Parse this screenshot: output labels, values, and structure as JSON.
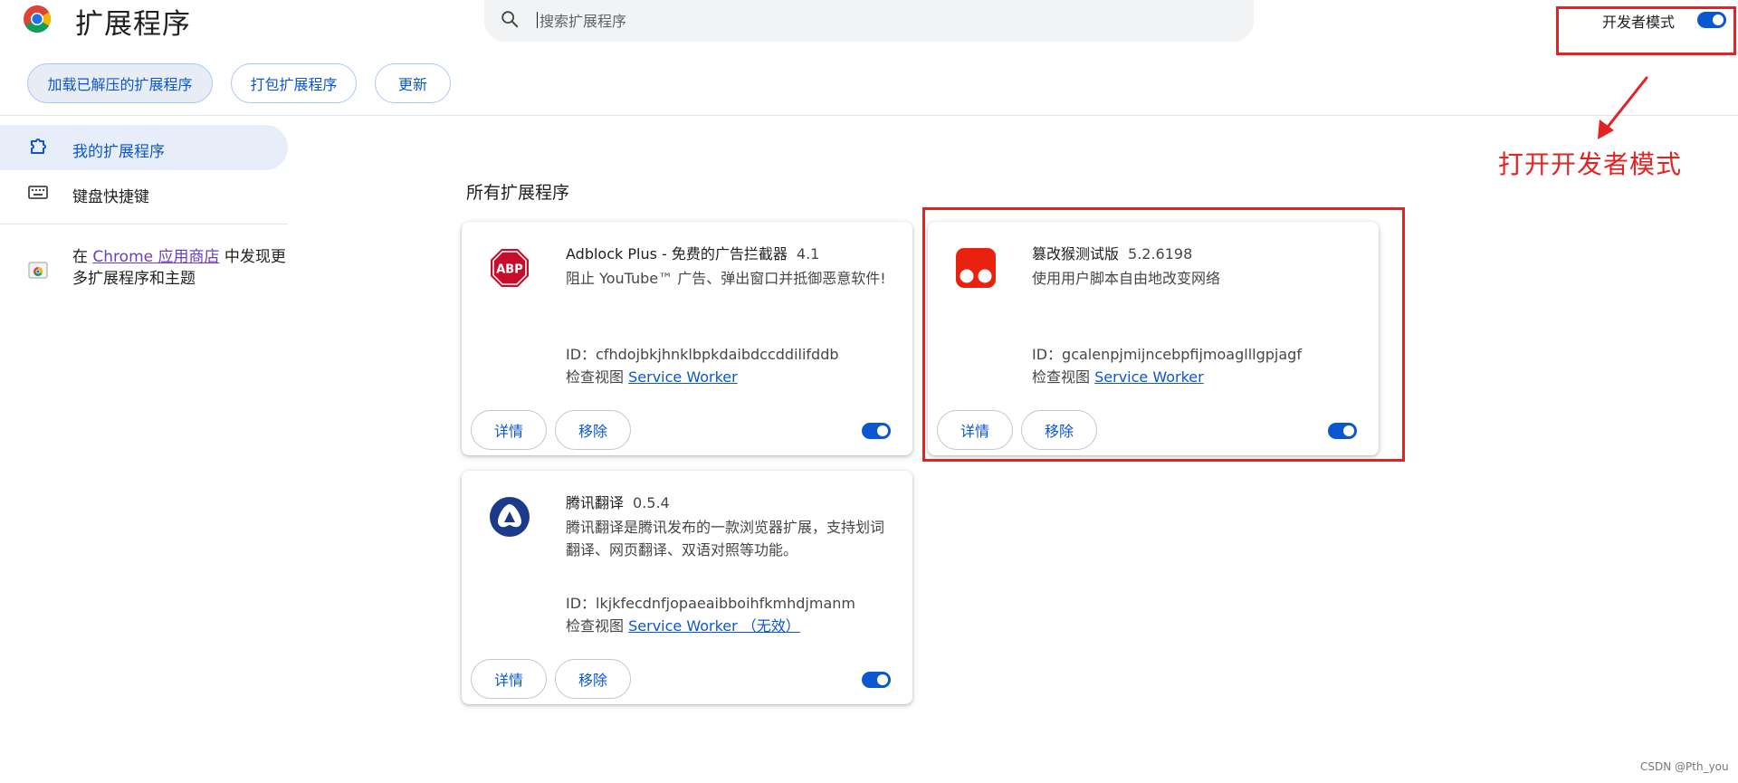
{
  "header": {
    "title": "扩展程序",
    "search_placeholder": "搜索扩展程序",
    "devmode_label": "开发者模式",
    "devmode_on": true
  },
  "toolbar": {
    "load_unpacked": "加载已解压的扩展程序",
    "pack": "打包扩展程序",
    "update": "更新"
  },
  "sidebar": {
    "items": [
      {
        "label": "我的扩展程序",
        "selected": true,
        "icon": "extension-puzzle-icon"
      },
      {
        "label": "键盘快捷键",
        "selected": false,
        "icon": "keyboard-icon"
      }
    ],
    "store": {
      "prefix": "在 ",
      "link": "Chrome 应用商店",
      "suffix": " 中发现更多扩展程序和主题",
      "icon": "chrome-web-store-icon"
    }
  },
  "section_title": "所有扩展程序",
  "extensions": [
    {
      "name": "Adblock Plus - 免费的广告拦截器",
      "version": "4.1",
      "description": "阻止 YouTube™ 广告、弹出窗口并抵御恶意软件!",
      "id_label": "ID：",
      "id": "cfhdojbkjhnklbpkdaibdccddilifddb",
      "inspect_label": "检查视图",
      "inspect_link": "Service Worker",
      "details": "详情",
      "remove": "移除",
      "enabled": true,
      "icon": "abp-icon",
      "icon_text": "ABP"
    },
    {
      "name": "篡改猴测试版",
      "version": "5.2.6198",
      "description": "使用用户脚本自由地改变网络",
      "id_label": "ID：",
      "id": "gcalenpjmijncebpfijmoaglllgpjagf",
      "inspect_label": "检查视图",
      "inspect_link": "Service Worker",
      "details": "详情",
      "remove": "移除",
      "enabled": true,
      "icon": "tampermonkey-icon"
    },
    {
      "name": "腾讯翻译",
      "version": "0.5.4",
      "description": "腾讯翻译是腾讯发布的一款浏览器扩展，支持划词翻译、网页翻译、双语对照等功能。",
      "id_label": "ID：",
      "id": "lkjkfecdnfjopaeaibboihfkmhdjmanm",
      "inspect_label": "检查视图",
      "inspect_link": "Service Worker （无效）",
      "details": "详情",
      "remove": "移除",
      "enabled": true,
      "icon": "tencent-translate-icon"
    }
  ],
  "annotation": {
    "text": "打开开发者模式",
    "color": "#e52222"
  },
  "watermark": "CSDN @Pth_you",
  "colors": {
    "accent": "#0b57d0",
    "sidebar_selected": "#e8eef9",
    "annotation": "#e52222"
  }
}
